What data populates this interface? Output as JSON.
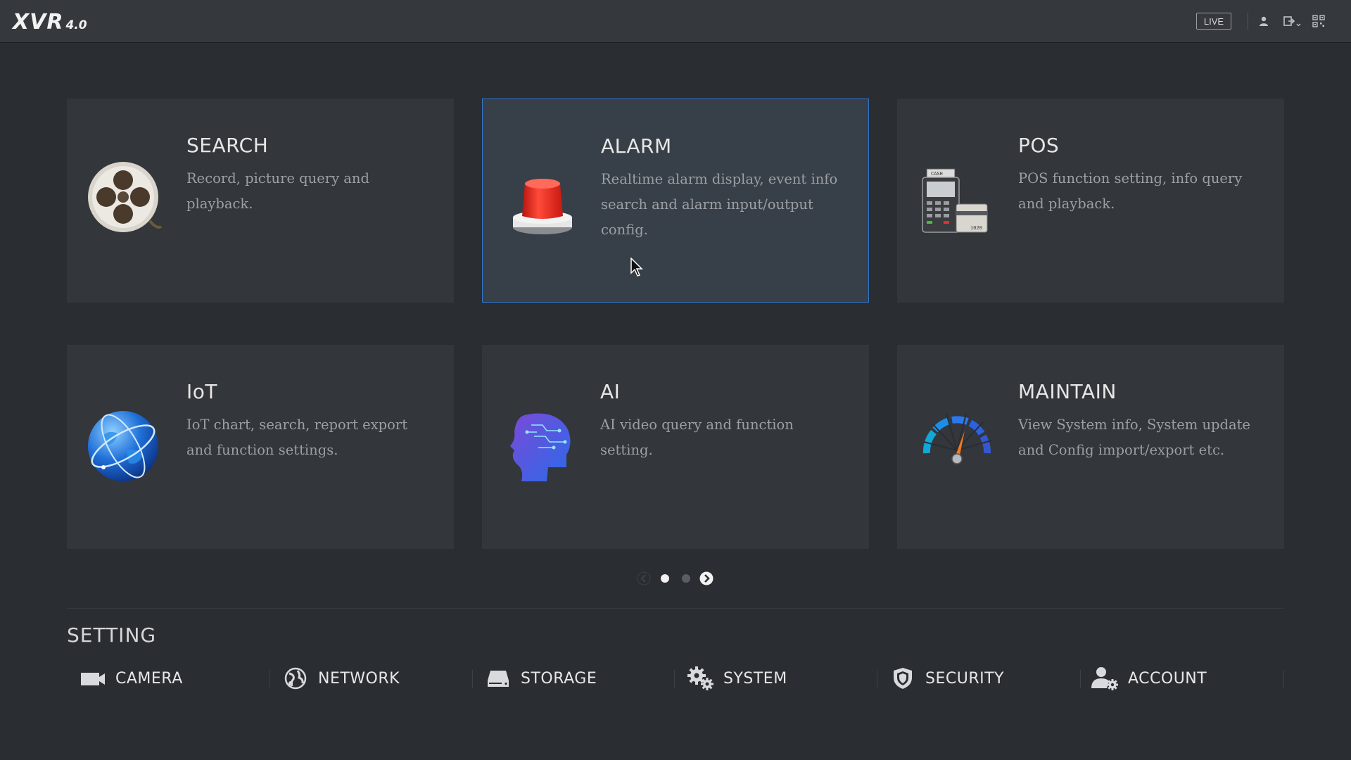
{
  "app": {
    "logo_text": "XVR",
    "logo_version": "4.0"
  },
  "topbar": {
    "live_label": "LIVE",
    "icons": [
      "user-icon",
      "logout-icon",
      "qr-code-icon"
    ]
  },
  "cards": [
    {
      "id": "search",
      "title": "SEARCH",
      "desc": "Record, picture query and playback.",
      "icon": "film-reel-icon"
    },
    {
      "id": "alarm",
      "title": "ALARM",
      "desc": "Realtime alarm display, event info search and alarm input/output config.",
      "icon": "alarm-light-icon",
      "active": true
    },
    {
      "id": "pos",
      "title": "POS",
      "desc": "POS function setting, info query and playback.",
      "icon": "cash-register-icon"
    },
    {
      "id": "iot",
      "title": "IoT",
      "desc": "IoT chart, search, report export and function settings.",
      "icon": "globe-icon"
    },
    {
      "id": "ai",
      "title": "AI",
      "desc": "AI video query and function setting.",
      "icon": "ai-head-icon"
    },
    {
      "id": "maintain",
      "title": "MAINTAIN",
      "desc": "View System info, System update and  Config import/export etc.",
      "icon": "gauge-icon"
    }
  ],
  "pager": {
    "pages": 2,
    "current": 1
  },
  "setting": {
    "title": "SETTING",
    "items": [
      {
        "label": "CAMERA",
        "icon": "camera-icon"
      },
      {
        "label": "NETWORK",
        "icon": "network-globe-icon"
      },
      {
        "label": "STORAGE",
        "icon": "storage-drive-icon"
      },
      {
        "label": "SYSTEM",
        "icon": "gears-icon"
      },
      {
        "label": "SECURITY",
        "icon": "shield-icon"
      },
      {
        "label": "ACCOUNT",
        "icon": "user-settings-icon"
      }
    ]
  },
  "colors": {
    "background": "#2a2d31",
    "card": "#33363a",
    "active_border": "#2f78d0",
    "alarm_red": "#e8231a"
  }
}
